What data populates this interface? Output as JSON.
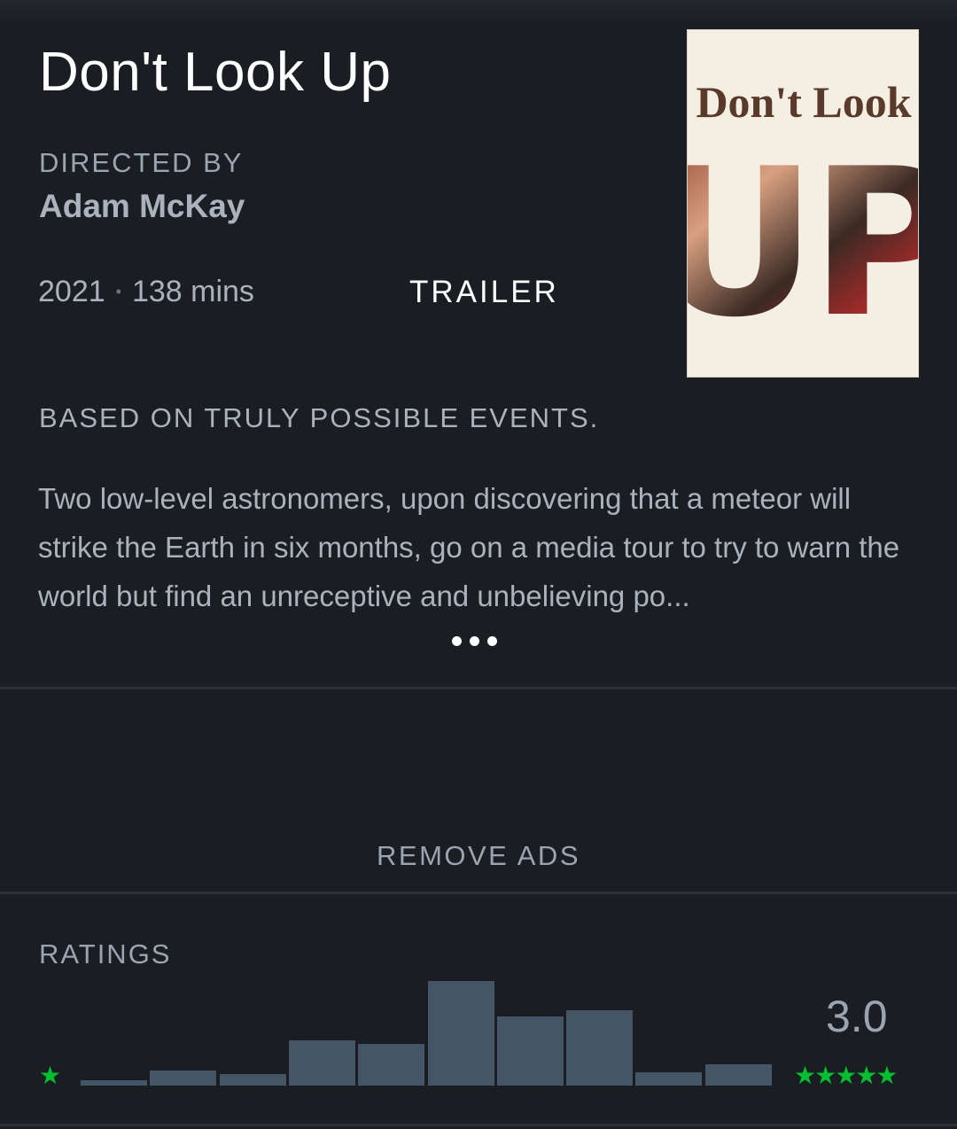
{
  "film": {
    "title": "Don't Look Up",
    "directed_by_label": "DIRECTED BY",
    "director": "Adam McKay",
    "year": "2021",
    "runtime": "138 mins",
    "trailer_label": "TRAILER",
    "poster": {
      "title_top": "Don't Look",
      "title_bottom": "UP"
    },
    "tagline": "BASED ON TRULY POSSIBLE EVENTS.",
    "synopsis": "Two low-level astronomers, upon discovering that a meteor will strike the Earth in six months, go on a media tour to try to warn the world but find an unreceptive and unbelieving po..."
  },
  "ads": {
    "remove_label": "REMOVE ADS"
  },
  "ratings": {
    "label": "RATINGS",
    "average": "3.0",
    "min_stars": "★",
    "max_stars": "★★★★★",
    "star_color": "#00c030",
    "bar_color": "#445566",
    "histogram_relative_heights": [
      0.05,
      0.14,
      0.11,
      0.43,
      0.4,
      1.0,
      0.66,
      0.72,
      0.13,
      0.2
    ]
  },
  "colors": {
    "background": "#1a1d21",
    "text_muted": "#9aa5b1",
    "title": "#ffffff"
  }
}
